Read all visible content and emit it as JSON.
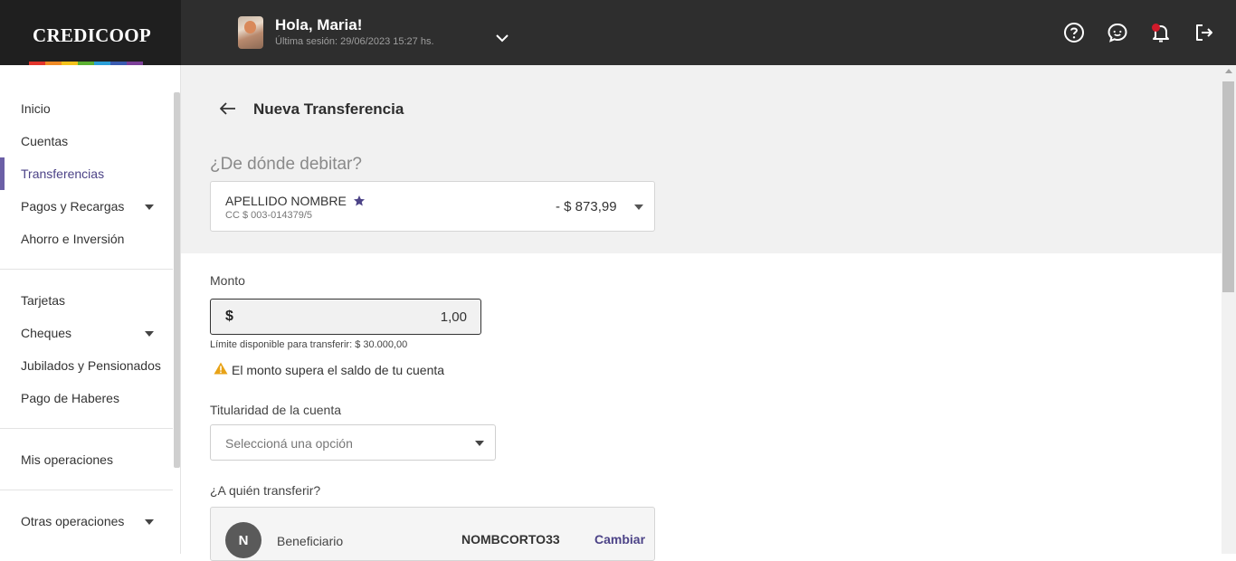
{
  "brand": {
    "name": "CREDICOOP",
    "stripe_colors": [
      "#e2342b",
      "#f08a24",
      "#f4c21a",
      "#5bb131",
      "#2a9fd8",
      "#3a5bb0",
      "#7c3f98"
    ]
  },
  "header": {
    "greeting": "Hola, Maria!",
    "last_session": "Última sesión: 29/06/2023 15:27 hs.",
    "icons": [
      "help-icon",
      "chat-icon",
      "bell-icon",
      "logout-icon"
    ]
  },
  "sidebar": {
    "items": [
      {
        "label": "Inicio"
      },
      {
        "label": "Cuentas"
      },
      {
        "label": "Transferencias",
        "active": true
      },
      {
        "label": "Pagos y Recargas",
        "has_submenu": true
      },
      {
        "label": "Ahorro e Inversión"
      },
      {
        "label": "Tarjetas"
      },
      {
        "label": "Cheques",
        "has_submenu": true
      },
      {
        "label": "Jubilados y Pensionados"
      },
      {
        "label": "Pago de Haberes"
      },
      {
        "label": "Mis operaciones"
      },
      {
        "label": "Otras operaciones",
        "has_submenu": true
      }
    ]
  },
  "page": {
    "title": "Nueva Transferencia",
    "debit_question": "¿De dónde debitar?",
    "account": {
      "name": "APELLIDO NOMBRE",
      "number": "CC $ 003-014379/5",
      "balance": "- $ 873,99"
    },
    "amount": {
      "label": "Monto",
      "currency": "$",
      "value": "1,00",
      "limit": "Límite disponible para transferir: $ 30.000,00",
      "warning": "El monto supera el saldo de tu cuenta"
    },
    "ownership": {
      "label": "Titularidad de la cuenta",
      "placeholder": "Seleccioná una opción"
    },
    "recipient": {
      "question": "¿A quién transferir?",
      "initial": "N",
      "label": "Beneficiario",
      "short_name": "NOMBCORTO33",
      "change_label": "Cambiar"
    }
  },
  "colors": {
    "accent": "#4c4387",
    "warning": "#e8a317",
    "notification": "#d11a2a"
  }
}
